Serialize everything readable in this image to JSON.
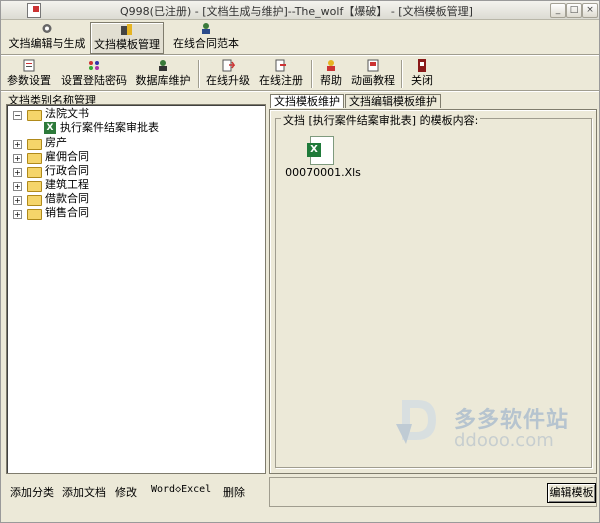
{
  "window": {
    "title": "Q998(已注册) - [文档生成与维护]--The_wolf【爆破】 - [文档模板管理]",
    "controls": [
      "_",
      "□",
      "×"
    ]
  },
  "main_tabs": [
    {
      "label": "文挡编辑与生成",
      "icon": "gear-icon"
    },
    {
      "label": "文挡模板管理",
      "icon": "template-icon",
      "active": true
    },
    {
      "label": "在线合同范本",
      "icon": "user-icon"
    }
  ],
  "toolbar": {
    "items": [
      {
        "label": "参数设置",
        "icon": "settings-icon"
      },
      {
        "label": "设置登陆密码",
        "icon": "password-icon"
      },
      {
        "label": "数据库维护",
        "icon": "database-icon"
      },
      {
        "label": "在线升级",
        "icon": "upgrade-icon"
      },
      {
        "label": "在线注册",
        "icon": "register-icon"
      },
      {
        "label": "帮助",
        "icon": "help-icon"
      },
      {
        "label": "动画教程",
        "icon": "tutorial-icon"
      },
      {
        "label": "关闭",
        "icon": "close-icon"
      }
    ]
  },
  "left_panel": {
    "title": "文挡类别名称管理",
    "tree": [
      {
        "label": "法院文书",
        "expanded": true,
        "children": [
          {
            "label": "执行案件结案审批表"
          }
        ]
      },
      {
        "label": "房产"
      },
      {
        "label": "雇佣合同"
      },
      {
        "label": "行政合同"
      },
      {
        "label": "建筑工程"
      },
      {
        "label": "借款合同"
      },
      {
        "label": "销售合同"
      }
    ],
    "actions": [
      "添加分类",
      "添加文档",
      "修改",
      "Word◇Excel",
      "删除"
    ]
  },
  "right_panel": {
    "tabs": [
      "文挡模板维护",
      "文挡编辑模板维护"
    ],
    "group_label": "文挡 [执行案件结案审批表] 的模板内容:",
    "files": [
      {
        "name": "00070001.Xls",
        "icon": "excel-file-icon"
      }
    ],
    "edit_button": "编辑模板"
  },
  "watermark": {
    "line1": "多多软件站",
    "line2": "ddooo.com"
  },
  "colors": {
    "face": "#ece9d8",
    "folder": "#f5d56a",
    "excel": "#1f7a3a"
  }
}
